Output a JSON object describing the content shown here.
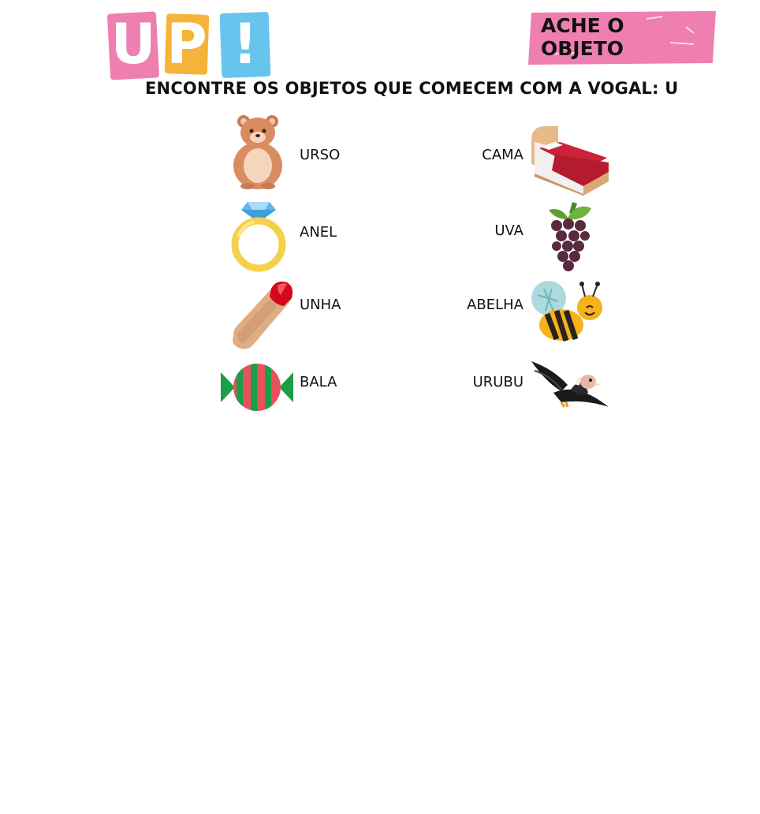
{
  "logo": {
    "letters": [
      "U",
      "P",
      "!"
    ]
  },
  "badge": {
    "text": "ACHE O OBJETO"
  },
  "instruction": "ENCONTRE OS OBJETOS QUE COMECEM COM A VOGAL: U",
  "items": {
    "left": [
      "URSO",
      "ANEL",
      "UNHA",
      "BALA"
    ],
    "right": [
      "CAMA",
      "UVA",
      "ABELHA",
      "URUBU"
    ]
  },
  "icons": {
    "left": [
      "bear-icon",
      "ring-icon",
      "fingernail-icon",
      "candy-icon"
    ],
    "right": [
      "bed-icon",
      "grapes-icon",
      "bee-icon",
      "vulture-icon"
    ]
  },
  "colors": {
    "pink": "#ef7fb1",
    "orange": "#f6b33a",
    "blue": "#67c4ec"
  }
}
